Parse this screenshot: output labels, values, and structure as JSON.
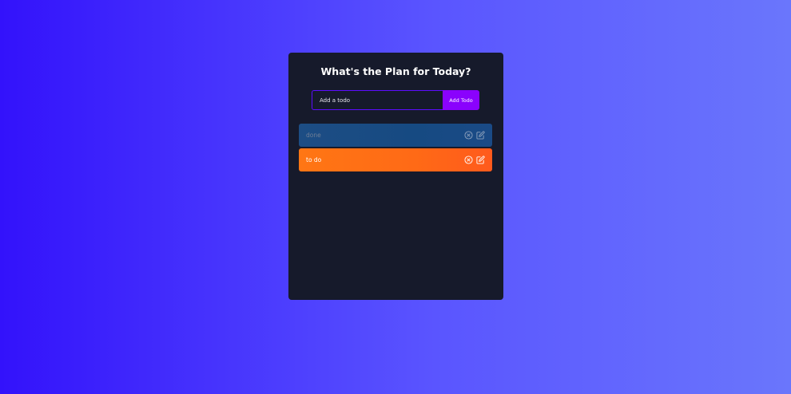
{
  "app": {
    "title": "What's the Plan for Today?"
  },
  "form": {
    "placeholder": "Add a todo",
    "value": "",
    "add_label": "Add Todo"
  },
  "todos": [
    {
      "text": "done",
      "completed": true,
      "color": "#1d4d84",
      "delete_icon": "close-circle-icon",
      "edit_icon": "edit-icon"
    },
    {
      "text": "to do",
      "completed": false,
      "color": "#ff6a16",
      "delete_icon": "close-circle-icon",
      "edit_icon": "edit-icon"
    }
  ],
  "colors": {
    "background_start": "#3312fb",
    "background_end": "#6a76fc",
    "panel": "#161a2b",
    "accent": "#8a02fd",
    "input_border": "#5d0cff"
  }
}
